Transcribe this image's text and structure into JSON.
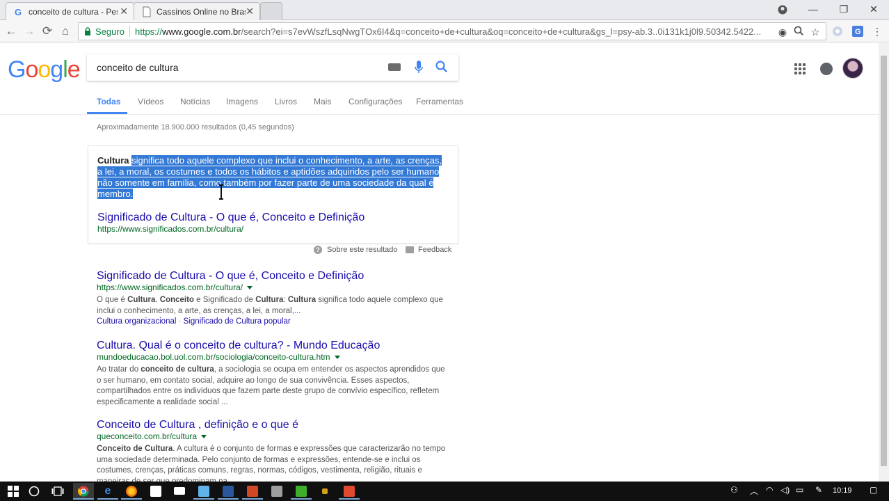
{
  "browser": {
    "tabs": [
      {
        "title": "conceito de cultura - Pes",
        "active": true
      },
      {
        "title": "Cassinos Online no Brasil",
        "active": false
      }
    ],
    "secure_label": "Seguro",
    "url": {
      "scheme": "https://",
      "host": "www.google.com.br",
      "rest": "/search?ei=s7evWszfLsqNwgTOx6I4&q=conceito+de+cultura&oq=conceito+de+cultura&gs_l=psy-ab.3..0i131k1j0l9.50342.5422..."
    }
  },
  "google": {
    "logo": "Google",
    "query": "conceito de cultura",
    "tabs": [
      "Todas",
      "Vídeos",
      "Notícias",
      "Imagens",
      "Livros",
      "Mais",
      "Configurações",
      "Ferramentas"
    ],
    "stats": "Aproximadamente 18.900.000 resultados (0,45 segundos)"
  },
  "featured_snippet": {
    "bold_word": "Cultura",
    "text": "significa todo aquele complexo que inclui o conhecimento, a arte, as crenças, a lei, a moral, os costumes e todos os hábitos e aptidões adquiridos pelo ser humano não somente em família, como também por fazer parte de uma sociedade da qual é membro.",
    "link_title": "Significado de Cultura - O que é, Conceito e Definição",
    "link_url": "https://www.significados.com.br/cultura/",
    "about_label": "Sobre este resultado",
    "feedback_label": "Feedback"
  },
  "results": [
    {
      "title": "Significado de Cultura - O que é, Conceito e Definição",
      "url": "https://www.significados.com.br/cultura/",
      "desc_parts": [
        "O que é ",
        "Cultura",
        ". ",
        "Conceito",
        " e Significado de ",
        "Cultura",
        ": ",
        "Cultura",
        " significa todo aquele complexo que inclui o conhecimento, a arte, as crenças, a lei, a moral,..."
      ],
      "sublinks": [
        "Cultura organizacional",
        "Significado de Cultura popular"
      ],
      "sublink_sep": " · "
    },
    {
      "title": "Cultura. Qual é o conceito de cultura? - Mundo Educação",
      "url": "mundoeducacao.bol.uol.com.br/sociologia/conceito-cultura.htm",
      "desc_parts": [
        "Ao tratar do ",
        "conceito de cultura",
        ", a sociologia se ocupa em entender os aspectos aprendidos que o ser humano, em contato social, adquire ao longo de sua convivência. Esses aspectos, compartilhados entre os indivíduos que fazem parte deste grupo de convívio específico, refletem especificamente a realidade social ..."
      ]
    },
    {
      "title": "Conceito de Cultura , definição e o que é",
      "url": "queconceito.com.br/cultura",
      "desc_parts": [
        "Conceito de Cultura",
        ". A cultura é o conjunto de formas e expressões que caracterizarão no tempo uma sociedade determinada. Pelo conjunto de formas e expressões, entende-se e inclui os costumes, crenças, práticas comuns, regras, normas, códigos, vestimenta, religião, rituais e maneiras de ser que predominam na ..."
      ]
    }
  ],
  "taskbar": {
    "clock": "10:19"
  },
  "colors": {
    "link": "#1a0dab",
    "url_green": "#006621",
    "selection": "#3379d6",
    "google_blue": "#4285f4"
  }
}
